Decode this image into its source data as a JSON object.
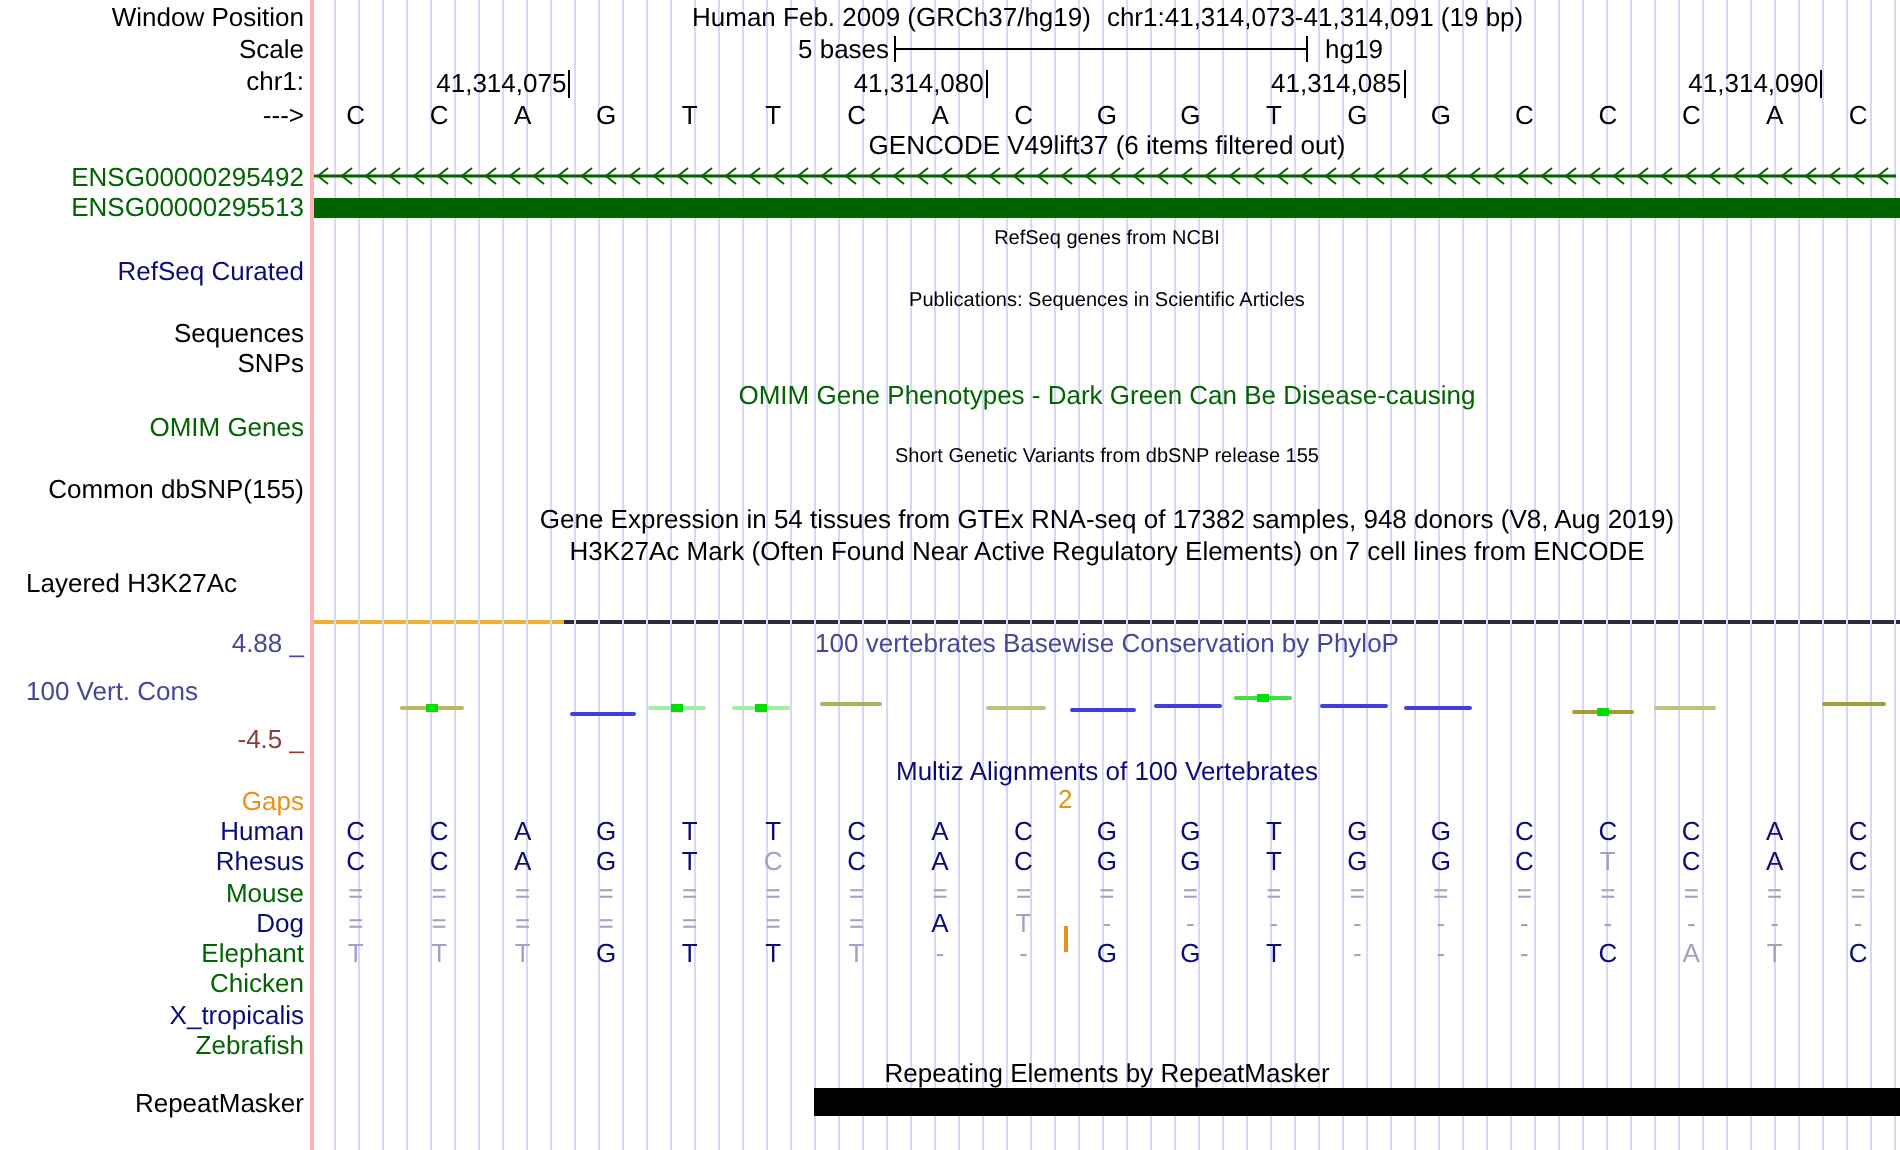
{
  "header": {
    "label": "Window Position",
    "assembly": "Human Feb. 2009 (GRCh37/hg19)",
    "position": "chr1:41,314,073-41,314,091 (19 bp)"
  },
  "scale": {
    "label": "Scale",
    "length": "5 bases",
    "assembly": "hg19"
  },
  "ruler": {
    "label": "chr1:",
    "ticks": [
      "41,314,075",
      "41,314,080",
      "41,314,085",
      "41,314,090"
    ]
  },
  "sequence": {
    "label": "--->",
    "bases": [
      "C",
      "C",
      "A",
      "G",
      "T",
      "T",
      "C",
      "A",
      "C",
      "G",
      "G",
      "T",
      "G",
      "G",
      "C",
      "C",
      "C",
      "A",
      "C"
    ]
  },
  "tracks": [
    {
      "kind": "title",
      "text": "GENCODE V49lift37 (6 items filtered out)",
      "color": "#000000"
    },
    {
      "kind": "gene_strand",
      "label": "ENSG00000295492",
      "color": "#006400"
    },
    {
      "kind": "gene_block",
      "label": "ENSG00000295513",
      "color": "#006400"
    },
    {
      "kind": "small_title",
      "text": "RefSeq genes from NCBI",
      "color": "#000000"
    },
    {
      "kind": "label",
      "label": "RefSeq Curated",
      "color": "#0c0c78"
    },
    {
      "kind": "small_title",
      "text": "Publications: Sequences in Scientific Articles",
      "color": "#000000"
    },
    {
      "kind": "label",
      "label": "Sequences",
      "color": "#000000"
    },
    {
      "kind": "label",
      "label": "SNPs",
      "color": "#000000"
    },
    {
      "kind": "title",
      "text": "OMIM Gene Phenotypes - Dark Green Can Be Disease-causing",
      "color": "#006400"
    },
    {
      "kind": "label",
      "label": "OMIM Genes",
      "color": "#006400"
    },
    {
      "kind": "small_title",
      "text": "Short Genetic Variants from dbSNP release 155",
      "color": "#000000"
    },
    {
      "kind": "label",
      "label": "Common dbSNP(155)",
      "color": "#000000"
    },
    {
      "kind": "title",
      "text": "Gene Expression in 54 tissues from GTEx RNA-seq of 17382 samples, 948 donors (V8, Aug 2019)",
      "color": "#000000"
    },
    {
      "kind": "title",
      "text": "H3K27Ac Mark (Often Found Near Active Regulatory Elements) on 7 cell lines from ENCODE",
      "color": "#000000"
    },
    {
      "kind": "group_label",
      "label": "Layered H3K27Ac",
      "color": "#000000"
    }
  ],
  "conservation": {
    "label": "100 Vert. Cons",
    "title": "100 vertebrates Basewise Conservation by PhyloP",
    "max": "4.88 _",
    "min": "-4.5 _"
  },
  "alignment": {
    "title": "Multiz Alignments of 100 Vertebrates",
    "gaps": {
      "label": "Gaps",
      "count": "2"
    },
    "species": [
      {
        "name": "Human",
        "color": "#0c0c78",
        "bases": [
          {
            "base": "C",
            "faded": false
          },
          {
            "base": "C",
            "faded": false
          },
          {
            "base": "A",
            "faded": false
          },
          {
            "base": "G",
            "faded": false
          },
          {
            "base": "T",
            "faded": false
          },
          {
            "base": "T",
            "faded": false
          },
          {
            "base": "C",
            "faded": false
          },
          {
            "base": "A",
            "faded": false
          },
          {
            "base": "C",
            "faded": false
          },
          {
            "base": "G",
            "faded": false
          },
          {
            "base": "G",
            "faded": false
          },
          {
            "base": "T",
            "faded": false
          },
          {
            "base": "G",
            "faded": false
          },
          {
            "base": "G",
            "faded": false
          },
          {
            "base": "C",
            "faded": false
          },
          {
            "base": "C",
            "faded": false
          },
          {
            "base": "C",
            "faded": false
          },
          {
            "base": "A",
            "faded": false
          },
          {
            "base": "C",
            "faded": false
          }
        ]
      },
      {
        "name": "Rhesus",
        "color": "#0c0c78",
        "bases": [
          {
            "base": "C",
            "faded": false
          },
          {
            "base": "C",
            "faded": false
          },
          {
            "base": "A",
            "faded": false
          },
          {
            "base": "G",
            "faded": false
          },
          {
            "base": "T",
            "faded": false
          },
          {
            "base": "C",
            "faded": true
          },
          {
            "base": "C",
            "faded": false
          },
          {
            "base": "A",
            "faded": false
          },
          {
            "base": "C",
            "faded": false
          },
          {
            "base": "G",
            "faded": false
          },
          {
            "base": "G",
            "faded": false
          },
          {
            "base": "T",
            "faded": false
          },
          {
            "base": "G",
            "faded": false
          },
          {
            "base": "G",
            "faded": false
          },
          {
            "base": "C",
            "faded": false
          },
          {
            "base": "T",
            "faded": true
          },
          {
            "base": "C",
            "faded": false
          },
          {
            "base": "A",
            "faded": false
          },
          {
            "base": "C",
            "faded": false
          }
        ]
      },
      {
        "name": "Mouse",
        "color": "#006400",
        "bases": [
          {
            "base": "=",
            "faded": true
          },
          {
            "base": "=",
            "faded": true
          },
          {
            "base": "=",
            "faded": true
          },
          {
            "base": "=",
            "faded": true
          },
          {
            "base": "=",
            "faded": true
          },
          {
            "base": "=",
            "faded": true
          },
          {
            "base": "=",
            "faded": true
          },
          {
            "base": "=",
            "faded": true
          },
          {
            "base": "=",
            "faded": true
          },
          {
            "base": "=",
            "faded": true
          },
          {
            "base": "=",
            "faded": true
          },
          {
            "base": "=",
            "faded": true
          },
          {
            "base": "=",
            "faded": true
          },
          {
            "base": "=",
            "faded": true
          },
          {
            "base": "=",
            "faded": true
          },
          {
            "base": "=",
            "faded": true
          },
          {
            "base": "=",
            "faded": true
          },
          {
            "base": "=",
            "faded": true
          },
          {
            "base": "=",
            "faded": true
          }
        ]
      },
      {
        "name": "Dog",
        "color": "#0c0c78",
        "bases": [
          {
            "base": "=",
            "faded": true
          },
          {
            "base": "=",
            "faded": true
          },
          {
            "base": "=",
            "faded": true
          },
          {
            "base": "=",
            "faded": true
          },
          {
            "base": "=",
            "faded": true
          },
          {
            "base": "=",
            "faded": true
          },
          {
            "base": "=",
            "faded": true
          },
          {
            "base": "A",
            "faded": false
          },
          {
            "base": "T",
            "faded": true
          },
          {
            "base": "-",
            "faded": true
          },
          {
            "base": "-",
            "faded": true
          },
          {
            "base": "-",
            "faded": true
          },
          {
            "base": "-",
            "faded": true
          },
          {
            "base": "-",
            "faded": true
          },
          {
            "base": "-",
            "faded": true
          },
          {
            "base": "-",
            "faded": true
          },
          {
            "base": "-",
            "faded": true
          },
          {
            "base": "-",
            "faded": true
          },
          {
            "base": "-",
            "faded": true
          }
        ]
      },
      {
        "name": "Elephant",
        "color": "#006400",
        "bases": [
          {
            "base": "T",
            "faded": true
          },
          {
            "base": "T",
            "faded": true
          },
          {
            "base": "T",
            "faded": true
          },
          {
            "base": "G",
            "faded": false
          },
          {
            "base": "T",
            "faded": false
          },
          {
            "base": "T",
            "faded": false
          },
          {
            "base": "T",
            "faded": true
          },
          {
            "base": "-",
            "faded": true
          },
          {
            "base": "-",
            "faded": true
          },
          {
            "kind": "insertion"
          },
          {
            "base": "G",
            "faded": false
          },
          {
            "base": "G",
            "faded": false
          },
          {
            "base": "T",
            "faded": false
          },
          {
            "base": "-",
            "faded": true
          },
          {
            "base": "-",
            "faded": true
          },
          {
            "base": "-",
            "faded": true
          },
          {
            "base": "C",
            "faded": false
          },
          {
            "base": "A",
            "faded": true
          },
          {
            "base": "T",
            "faded": true
          },
          {
            "base": "C",
            "faded": false
          }
        ]
      },
      {
        "name": "Chicken",
        "color": "#006400"
      },
      {
        "name": "X_tropicalis",
        "color": "#0c0c78"
      },
      {
        "name": "Zebrafish",
        "color": "#006400"
      }
    ]
  },
  "repeats": {
    "title": "Repeating Elements by RepeatMasker",
    "label": "RepeatMasker"
  }
}
